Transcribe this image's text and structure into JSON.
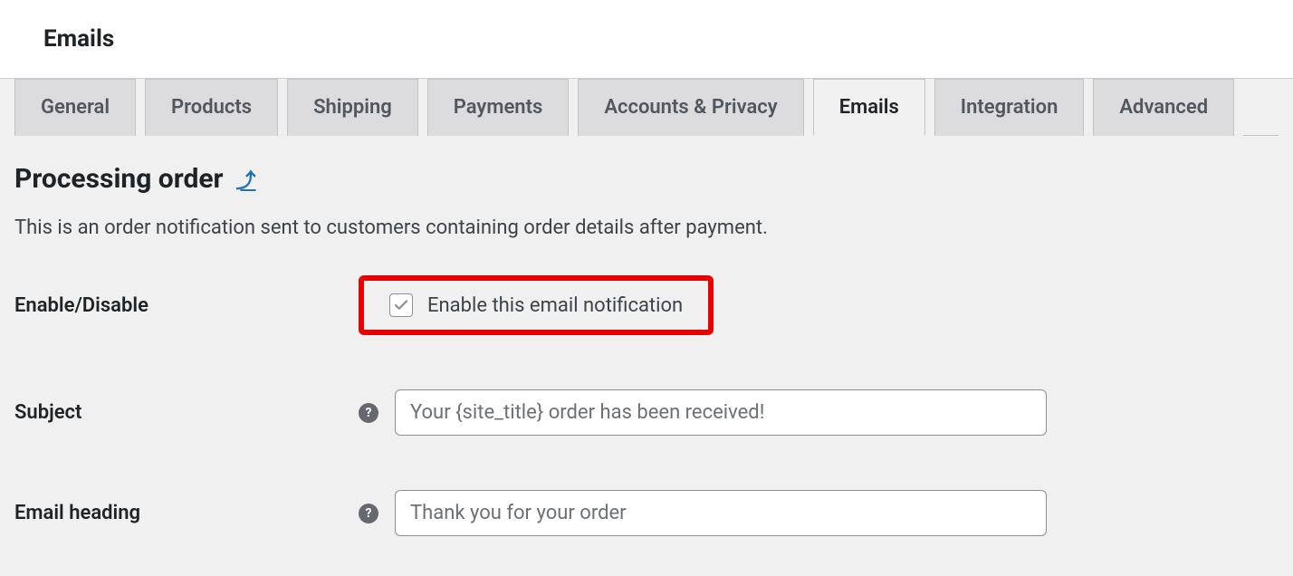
{
  "topbar": {
    "title": "Emails"
  },
  "tabs": [
    {
      "label": "General",
      "active": false
    },
    {
      "label": "Products",
      "active": false
    },
    {
      "label": "Shipping",
      "active": false
    },
    {
      "label": "Payments",
      "active": false
    },
    {
      "label": "Accounts & Privacy",
      "active": false
    },
    {
      "label": "Emails",
      "active": true
    },
    {
      "label": "Integration",
      "active": false
    },
    {
      "label": "Advanced",
      "active": false
    }
  ],
  "page": {
    "heading": "Processing order",
    "back_glyph": "⤴",
    "description": "This is an order notification sent to customers containing order details after payment."
  },
  "fields": {
    "enable": {
      "label": "Enable/Disable",
      "checkbox_label": "Enable this email notification",
      "checked": true
    },
    "subject": {
      "label": "Subject",
      "placeholder": "Your {site_title} order has been received!",
      "value": ""
    },
    "email_heading": {
      "label": "Email heading",
      "placeholder": "Thank you for your order",
      "value": ""
    }
  }
}
